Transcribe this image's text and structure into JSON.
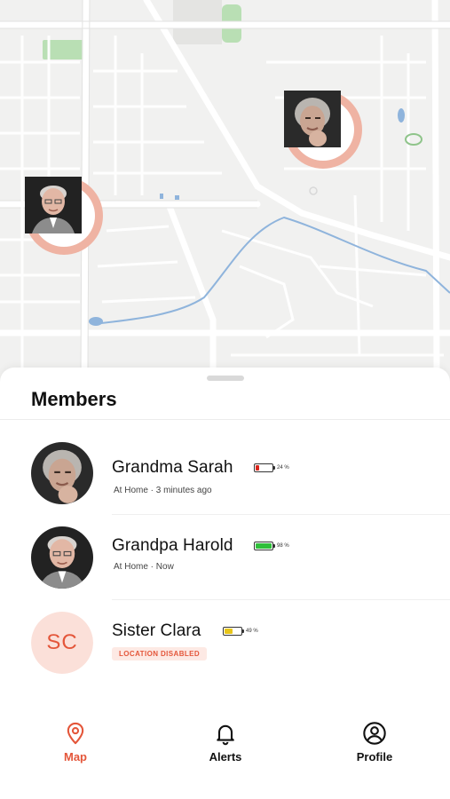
{
  "map": {
    "markers": [
      {
        "member": "Grandma Sarah",
        "ring_color": "#efb3a3"
      },
      {
        "member": "Grandpa Harold",
        "ring_color": "#efb3a3"
      }
    ]
  },
  "sheet": {
    "title": "Members"
  },
  "members": [
    {
      "name": "Grandma Sarah",
      "status": "At Home · 3 minutes ago",
      "battery_pct": "24 %",
      "battery_level": 0.24,
      "battery_color": "#d9261c"
    },
    {
      "name": "Grandpa Harold",
      "status": "At Home · Now",
      "battery_pct": "98 %",
      "battery_level": 0.98,
      "battery_color": "#2fbf3a"
    },
    {
      "name": "Sister Clara",
      "initials": "SC",
      "battery_pct": "49 %",
      "battery_level": 0.49,
      "battery_color": "#e7c51b",
      "badge": "LOCATION DISABLED"
    }
  ],
  "tabs": [
    {
      "label": "Map",
      "icon": "map-pin-icon",
      "active": true
    },
    {
      "label": "Alerts",
      "icon": "bell-icon",
      "active": false
    },
    {
      "label": "Profile",
      "icon": "user-circle-icon",
      "active": false
    }
  ],
  "colors": {
    "accent": "#e4563a",
    "marker_ring": "#efb3a3",
    "map_bg": "#f1f1f0",
    "water": "#8fb4dc",
    "park": "#b9dfb4"
  }
}
